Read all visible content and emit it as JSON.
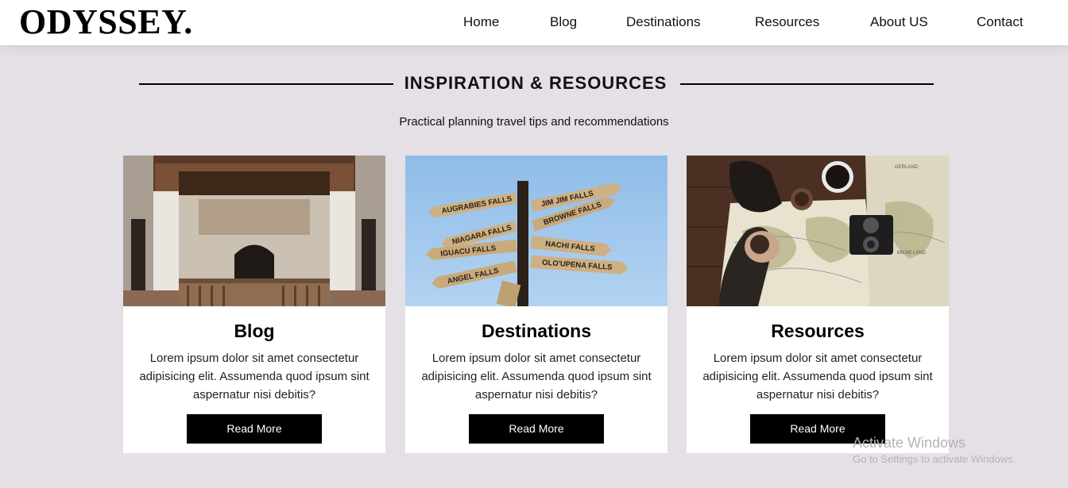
{
  "brand": {
    "logo": "ODYSSEY."
  },
  "nav": {
    "items": [
      {
        "label": "Home"
      },
      {
        "label": "Blog"
      },
      {
        "label": "Destinations"
      },
      {
        "label": "Resources"
      },
      {
        "label": "About US"
      },
      {
        "label": "Contact"
      }
    ]
  },
  "section": {
    "title": "INSPIRATION & RESOURCES",
    "subtitle": "Practical planning travel tips and recommendations"
  },
  "cards": [
    {
      "image": "moroccan-courtyard-photo",
      "title": "Blog",
      "text": "Lorem ipsum dolor sit amet consectetur adipisicing elit. Assumenda quod ipsum sint aspernatur nisi debitis?",
      "button": "Read More"
    },
    {
      "image": "signpost-photo",
      "title": "Destinations",
      "text": "Lorem ipsum dolor sit amet consectetur adipisicing elit. Assumenda quod ipsum sint aspernatur nisi debitis?",
      "button": "Read More",
      "signs": [
        "AUGRABIES FALLS",
        "JIM JIM FALLS",
        "BROWNE FALLS",
        "NIAGARA FALLS",
        "NACHI FALLS",
        "IGUACU FALLS",
        "OLO'UPENA FALLS",
        "ANGEL FALLS"
      ]
    },
    {
      "image": "map-and-camera-photo",
      "title": "Resources",
      "text": "Lorem ipsum dolor sit amet consectetur adipisicing elit. Assumenda quod ipsum sint aspernatur nisi debitis?",
      "button": "Read More",
      "map_labels": [
        "GERLAND",
        "MILNE LAND"
      ]
    }
  ],
  "watermark": {
    "title": "Activate Windows",
    "subtitle": "Go to Settings to activate Windows."
  },
  "colors": {
    "page_background": "#e4e0e6",
    "card_background": "#ffffff",
    "button_background": "#000000",
    "button_text": "#ffffff",
    "sky": "#9cc4ea"
  }
}
